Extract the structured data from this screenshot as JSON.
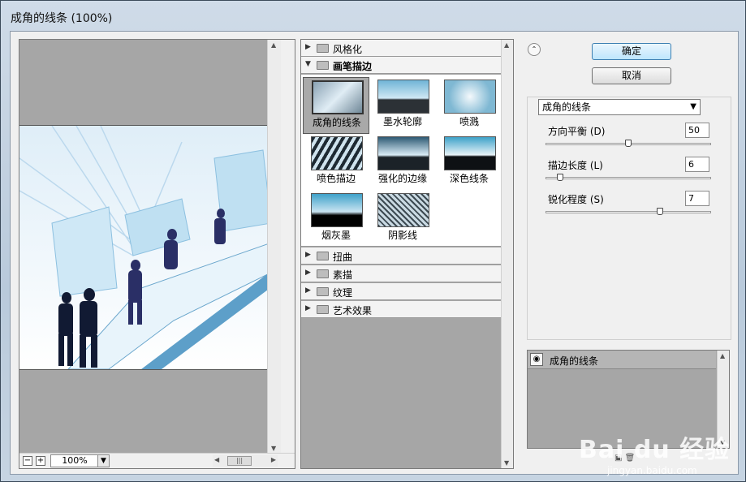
{
  "window": {
    "title": "成角的线条 (100%)"
  },
  "preview": {
    "zoom": "100%"
  },
  "gallery": {
    "categories_top": [
      {
        "label": "风格化",
        "open": false
      },
      {
        "label": "画笔描边",
        "open": true
      }
    ],
    "thumbnails": [
      {
        "label": "成角的线条",
        "selected": true
      },
      {
        "label": "墨水轮廓",
        "selected": false
      },
      {
        "label": "喷溅",
        "selected": false
      },
      {
        "label": "喷色描边",
        "selected": false
      },
      {
        "label": "强化的边缘",
        "selected": false
      },
      {
        "label": "深色线条",
        "selected": false
      },
      {
        "label": "烟灰墨",
        "selected": false
      },
      {
        "label": "阴影线",
        "selected": false
      }
    ],
    "categories_bottom": [
      {
        "label": "扭曲"
      },
      {
        "label": "素描"
      },
      {
        "label": "纹理"
      },
      {
        "label": "艺术效果"
      }
    ]
  },
  "buttons": {
    "ok": "确定",
    "cancel": "取消"
  },
  "settings": {
    "filter": "成角的线条",
    "params": [
      {
        "label": "方向平衡 (D)",
        "value": "50",
        "level": 0.5
      },
      {
        "label": "描边长度 (L)",
        "value": "6",
        "level": 0.067
      },
      {
        "label": "锐化程度 (S)",
        "value": "7",
        "level": 0.7
      }
    ]
  },
  "layers": {
    "items": [
      {
        "name": "成角的线条"
      }
    ]
  },
  "watermark": {
    "brand": "Bai du 经验",
    "url": "jingyan.baidu.com"
  }
}
